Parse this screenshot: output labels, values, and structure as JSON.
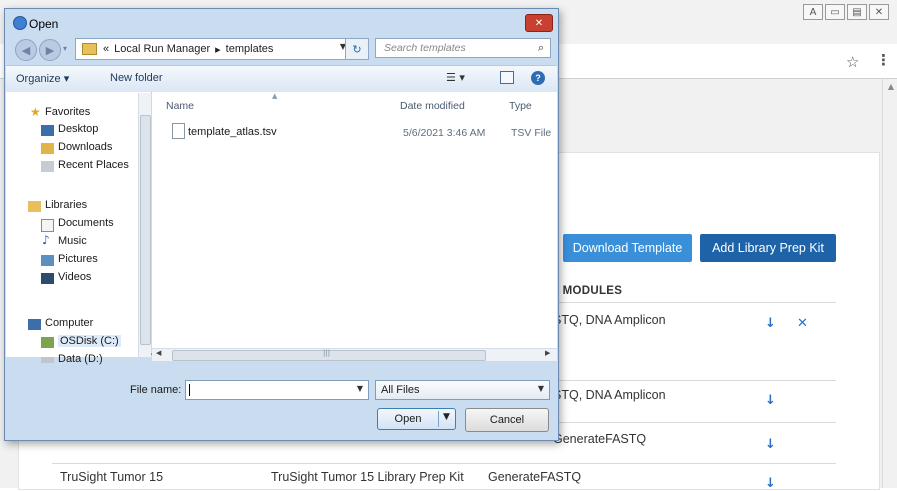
{
  "browser": {
    "window_controls": [
      "A",
      "▭",
      "▤",
      "✕"
    ],
    "bookmark_icon": "star-icon",
    "menu_icon": "kebab-icon"
  },
  "page": {
    "download_template_label": "Download Template",
    "add_kit_label": "Add Library Prep Kit",
    "col_header": "MODULES",
    "rows": [
      {
        "c1": "",
        "c2": "",
        "c3": "STQ, DNA Amplicon",
        "has_delete": true
      },
      {
        "c1": "",
        "c2": "",
        "c3": "STQ, DNA Amplicon",
        "has_delete": false
      },
      {
        "c1": "TruSight Tumor 15",
        "c2": "TruSight Tumor 15 Library Prep Kit",
        "c3": "GenerateFASTQ",
        "has_delete": false
      },
      {
        "c1": "TruSight Tumor 15",
        "c2": "TruSight Tumor 15 Library Prep Kit",
        "c3": "GenerateFASTQ",
        "has_delete": false
      }
    ],
    "download_icon": "↓",
    "delete_icon": "✕",
    "accent_color": "#3a8fd9",
    "accent_dark": "#1e63a8"
  },
  "dialog": {
    "title": "Open",
    "close_glyph": "✕",
    "path": {
      "chevron": "«",
      "seg1": "Local Run Manager",
      "sep": "▸",
      "seg2": "templates"
    },
    "search_placeholder": "Search templates",
    "toolbar": {
      "organize": "Organize ▾",
      "new_folder": "New folder"
    },
    "nav": {
      "favorites": "Favorites",
      "desktop": "Desktop",
      "downloads": "Downloads",
      "recent": "Recent Places",
      "libraries": "Libraries",
      "documents": "Documents",
      "music": "Music",
      "pictures": "Pictures",
      "videos": "Videos",
      "computer": "Computer",
      "osdisk": "OSDisk (C:)",
      "data": "Data (D:)"
    },
    "columns": {
      "name": "Name",
      "date": "Date modified",
      "type": "Type"
    },
    "files": [
      {
        "name": "template_atlas.tsv",
        "date": "5/6/2021 3:46 AM",
        "type": "TSV File"
      }
    ],
    "filename_label": "File name:",
    "filename_value": "",
    "filter": "All Files",
    "open_label": "Open",
    "cancel_label": "Cancel"
  }
}
